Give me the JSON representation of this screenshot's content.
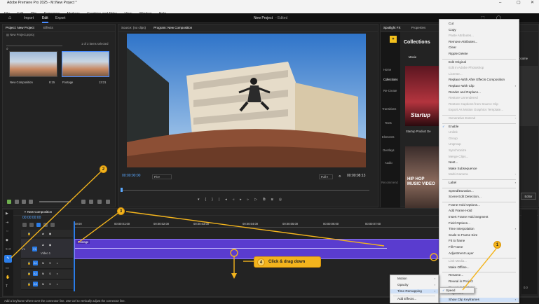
{
  "window": {
    "title": "Adobe Premiere Pro 2025 - M:\\New Project *",
    "controls": [
      "–",
      "▢",
      "✕"
    ]
  },
  "menubar": [
    "File",
    "Edit",
    "Clip",
    "Sequence",
    "Markers",
    "Graphics and Titles",
    "View",
    "Window",
    "Help"
  ],
  "topnav": {
    "import": "Import",
    "edit": "Edit",
    "export": "Export",
    "project_title": "New Project",
    "project_status": "- Edited"
  },
  "project_panel": {
    "tab_project": "Project: New Project",
    "tab_effects": "Effects",
    "file": "New Project.prproj",
    "selection": "1 of 2 items selected",
    "items": [
      {
        "name": "New Composition",
        "duration": "8:15"
      },
      {
        "name": "Footage",
        "duration": "13:21"
      }
    ]
  },
  "program_monitor": {
    "tab_source": "Source: (no clips)",
    "tab_program": "Program: New Composition",
    "timecode_left": "00:00:00:00",
    "fit": "Fit",
    "quality": "Full",
    "timecode_right": "00:00:08:13"
  },
  "spotlight": {
    "tab_spotlight": "Spotlight FX",
    "tab_properties": "Properties",
    "title": "Collections",
    "movies_label": "Movie",
    "sidebar": [
      "Home",
      "Collections",
      "Re-Create",
      "Transitions",
      "Texts",
      "Elements",
      "Overlays",
      "Audio",
      "Recommend"
    ],
    "cards": [
      {
        "title": "Startup",
        "label": "Startup Product De"
      },
      {
        "title": "HIP HOP MUSIC VIDEO",
        "label": "Hip Hop Music Video"
      }
    ],
    "extra_label": "rocome",
    "edit_label": "Editor"
  },
  "timeline": {
    "tab": "New Composition",
    "timecode": "00:00:00:00",
    "ruler": [
      ":00:00",
      "00:00:01:00",
      "00:00:02:00",
      "00:00:03:00",
      "00:00:04:00",
      "00:00:05:00",
      "00:00:06:00",
      "00:00:07:00"
    ],
    "tracks": [
      {
        "id": "V1",
        "label": "Video 1"
      },
      {
        "id": "A1",
        "label": "A1"
      },
      {
        "id": "A2",
        "label": "A2"
      },
      {
        "id": "A3",
        "label": "A3"
      }
    ],
    "clip_label": "Footage",
    "master": "Mix",
    "meter_value": "0.0"
  },
  "statusbar": {
    "text": "Add a keyframe where over the connector line. Use Ctrl to vertically adjust the connector line."
  },
  "context_menu": {
    "items": [
      {
        "label": "Cut",
        "disabled": false
      },
      {
        "label": "Copy",
        "disabled": false
      },
      {
        "label": "Paste Attributes...",
        "disabled": true
      },
      {
        "label": "Remove Attributes...",
        "disabled": false
      },
      {
        "label": "Clear",
        "disabled": false
      },
      {
        "label": "Ripple Delete",
        "disabled": false
      },
      {
        "label": "Edit Original",
        "disabled": false
      },
      {
        "label": "Edit in Adobe Photoshop",
        "disabled": true
      },
      {
        "label": "License...",
        "disabled": true
      },
      {
        "label": "Replace With After Effects Composition",
        "disabled": false
      },
      {
        "label": "Replace With Clip",
        "disabled": false,
        "submenu": true
      },
      {
        "label": "Render and Replace...",
        "disabled": false
      },
      {
        "label": "Restore Unrendered",
        "disabled": true
      },
      {
        "label": "Restore Captions from Source Clip",
        "disabled": true
      },
      {
        "label": "Export As Motion Graphics Template...",
        "disabled": true
      },
      {
        "label": "Generative Extend",
        "disabled": true,
        "submenu": true
      },
      {
        "label": "Enable",
        "disabled": false,
        "checked": true
      },
      {
        "label": "Unlink",
        "disabled": true
      },
      {
        "label": "Group",
        "disabled": true
      },
      {
        "label": "Ungroup",
        "disabled": true
      },
      {
        "label": "Synchronize",
        "disabled": true
      },
      {
        "label": "Merge Clips...",
        "disabled": true
      },
      {
        "label": "Nest...",
        "disabled": false
      },
      {
        "label": "Make Subsequence",
        "disabled": false
      },
      {
        "label": "Multi-Camera",
        "disabled": true,
        "submenu": true
      },
      {
        "label": "Label",
        "disabled": false,
        "submenu": true
      },
      {
        "label": "Speed/Duration...",
        "disabled": false
      },
      {
        "label": "Scene Edit Detection...",
        "disabled": false
      },
      {
        "label": "Frame Hold Options...",
        "disabled": false
      },
      {
        "label": "Add Frame Hold",
        "disabled": false
      },
      {
        "label": "Insert Frame Hold Segment",
        "disabled": false
      },
      {
        "label": "Field Options...",
        "disabled": false
      },
      {
        "label": "Time Interpolation",
        "disabled": false,
        "submenu": true
      },
      {
        "label": "Scale to Frame Size",
        "disabled": false
      },
      {
        "label": "Fit to frame",
        "disabled": false
      },
      {
        "label": "Fill Frame",
        "disabled": false
      },
      {
        "label": "Adjustment Layer",
        "disabled": false
      },
      {
        "label": "Link Media...",
        "disabled": true
      },
      {
        "label": "Make Offline...",
        "disabled": false
      },
      {
        "label": "Rename...",
        "disabled": false
      },
      {
        "label": "Reveal in Project",
        "disabled": false
      },
      {
        "label": "Reveal in Explorer...",
        "disabled": false
      },
      {
        "label": "Properties",
        "disabled": false
      },
      {
        "label": "Show Clip Keyframes",
        "disabled": false,
        "submenu": true,
        "highlight": true
      }
    ]
  },
  "keyframes_submenu": {
    "items": [
      {
        "label": "Motion",
        "submenu": true
      },
      {
        "label": "Opacity",
        "submenu": true
      },
      {
        "label": "Time Remapping",
        "submenu": true,
        "highlight": true
      },
      {
        "label": "Add Effects...",
        "submenu": false
      }
    ]
  },
  "remap_submenu": {
    "items": [
      {
        "label": "Speed",
        "checked": true
      }
    ]
  },
  "callouts": {
    "one": "1",
    "two": "2",
    "three": "3",
    "four": "4",
    "four_text": "Click & drag down"
  },
  "colors": {
    "accent": "#4a8cff",
    "clip": "#5a3ccf",
    "callout": "#f3b41d",
    "menu_highlight": "#cfe0f7"
  }
}
